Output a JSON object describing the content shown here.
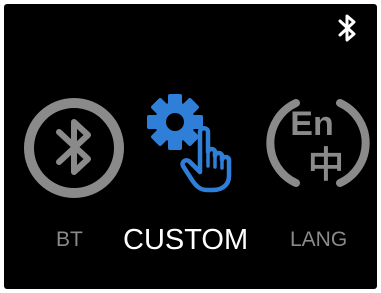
{
  "status_bar": {
    "bluetooth_icon": "bluetooth-icon",
    "color": "#ffffff"
  },
  "menu": {
    "selected": "CUSTOM",
    "items": [
      {
        "label": "BT",
        "icon": "bluetooth-circle-icon",
        "color": "#8a8a8a"
      },
      {
        "label": "CUSTOM",
        "icon": "gear-with-hand-icon",
        "color": "#ffffff",
        "icon_color": "#2f7fd8"
      },
      {
        "label": "LANG",
        "icon": "language-en-zh-icon",
        "color": "#8a8a8a",
        "icon_text_en": "En",
        "icon_text_zh": "中"
      }
    ]
  }
}
